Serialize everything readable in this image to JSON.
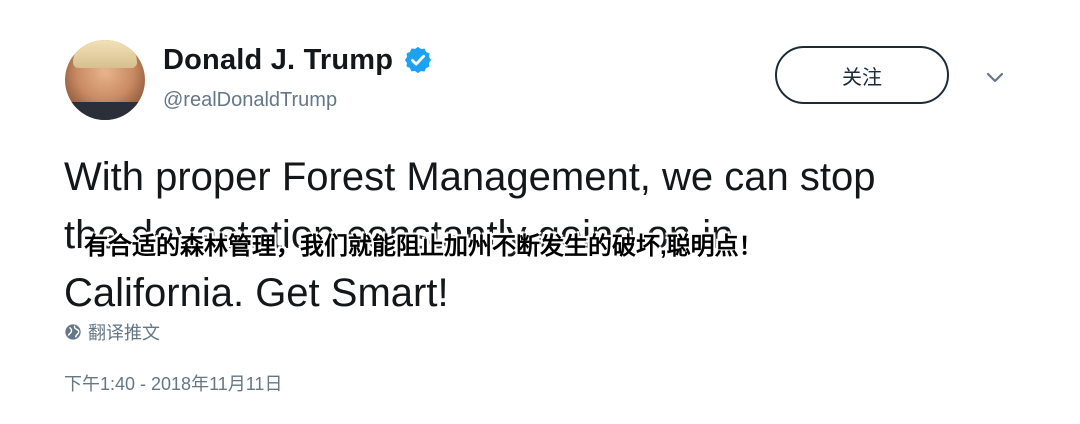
{
  "tweet": {
    "display_name": "Donald J. Trump",
    "handle": "@realDonaldTrump",
    "follow_label": "关注",
    "text": "With proper Forest Management, we can stop\nthe devastation constantly going on in\nCalifornia. Get Smart!",
    "subtitle": "有合适的森林管理，我们就能阻止加州不断发生的破坏,聪明点！",
    "translate_label": "翻译推文",
    "timestamp": "下午1:40 - 2018年11月11日",
    "verified_color": "#1da1f2",
    "icons": [
      "avatar",
      "verified-badge-icon",
      "chevron-down-icon",
      "globe-icon"
    ]
  }
}
